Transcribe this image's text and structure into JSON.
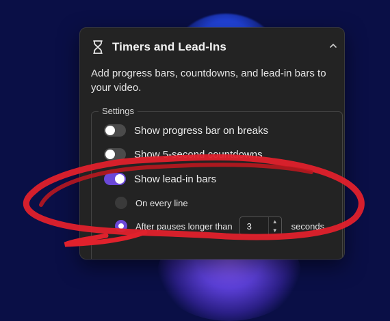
{
  "panel": {
    "title": "Timers and Lead-Ins",
    "description": "Add progress bars, countdowns, and lead-in bars to your video."
  },
  "settings": {
    "legend": "Settings",
    "toggles": [
      {
        "label": "Show progress bar on breaks",
        "on": false
      },
      {
        "label": "Show 5-second countdowns",
        "on": false
      },
      {
        "label": "Show lead-in bars",
        "on": true
      }
    ],
    "lead_in_options": {
      "every_line_label": "On every line",
      "pauses_label": "After pauses longer than",
      "pause_value": "3",
      "unit_label": "seconds",
      "selected": "pauses"
    }
  },
  "colors": {
    "accent": "#6b48d8",
    "panel_bg": "#232323",
    "page_bg": "#0a0f46",
    "annotation": "#e0212c"
  },
  "icons": {
    "header": "hourglass-icon",
    "collapse": "chevron-up-icon"
  }
}
